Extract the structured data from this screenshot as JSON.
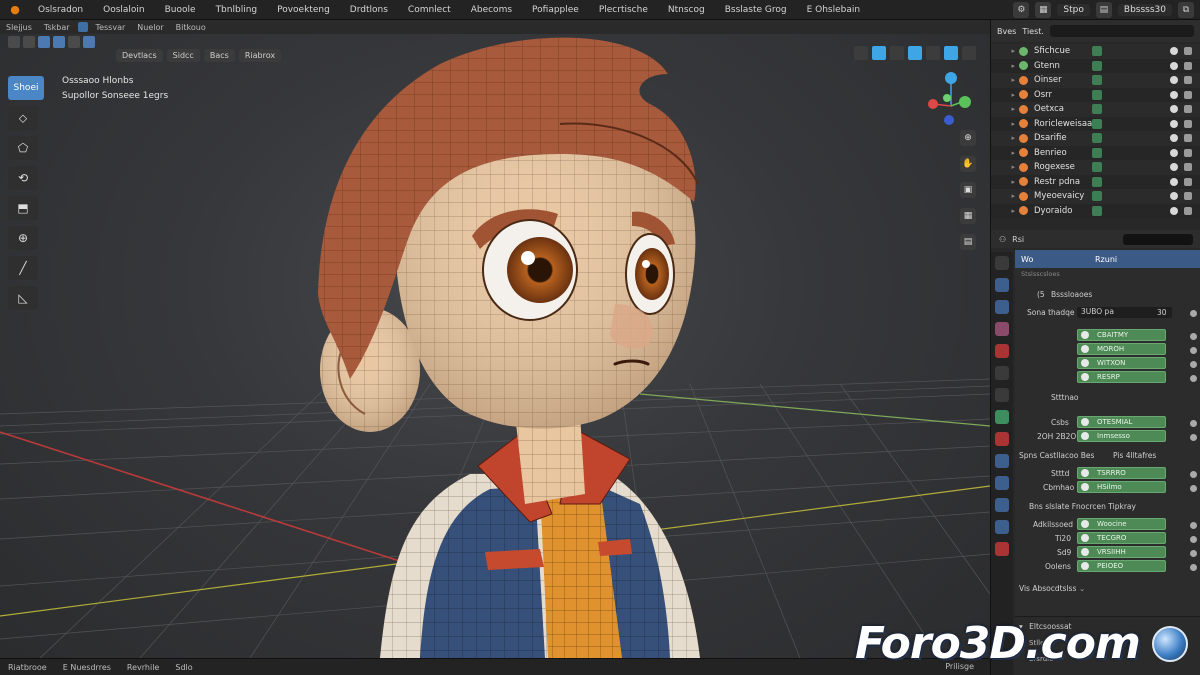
{
  "menubar": {
    "items": [
      "Oslsradon",
      "Ooslaloin",
      "Buoole",
      "Tbnlbling",
      "Povoekteng",
      "Drdtlons",
      "Comnlect",
      "Abecoms",
      "Pofiapplee",
      "Plecrtische",
      "Ntnscog",
      "Bsslaste Grog",
      "E Ohslebain"
    ],
    "scene_name": "Bbssss30",
    "scene_label": "Stpo"
  },
  "header2": {
    "items": [
      "Slejjus",
      "Tskbar",
      "Tessvar",
      "Nuelor",
      "Bitkouo"
    ]
  },
  "viewport": {
    "mode_buttons": [
      "Devtlacs",
      "Sidcc",
      "Bacs",
      "Riabrox"
    ],
    "overlay_line1": "Osssaoo Hlonbs",
    "overlay_line2": "Supollor Sonseee 1egrs",
    "tools": [
      "Shoei",
      "⬦",
      "⬠",
      "⟲",
      "⬒",
      "⊕",
      "╱",
      "◺"
    ]
  },
  "statusbar": {
    "items": [
      "Riatbrooe",
      "E Nuesdrres",
      "Revrhile",
      "Sdlo"
    ],
    "right_text": "Prilisge"
  },
  "outliner": {
    "tab_label": "Bves",
    "tab_label2": "Tiest.",
    "rows": [
      {
        "label": "Sfichcue",
        "obj": "green"
      },
      {
        "label": "Gtenn",
        "obj": "green"
      },
      {
        "label": "Oinser",
        "obj": "orange"
      },
      {
        "label": "Osrr",
        "obj": "orange"
      },
      {
        "label": "Oetxca",
        "obj": "orange"
      },
      {
        "label": "Roricleweisaar",
        "obj": "orange"
      },
      {
        "label": "Dsarifie",
        "obj": "orange"
      },
      {
        "label": "Benrieo",
        "obj": "orange"
      },
      {
        "label": "Rogexese",
        "obj": "orange"
      },
      {
        "label": "Restr pdna",
        "obj": "orange"
      },
      {
        "label": "Myeoevaicy",
        "obj": "orange"
      },
      {
        "label": "Dyoraido",
        "obj": "orange"
      }
    ]
  },
  "properties": {
    "head_label": "Rsi",
    "title_left": "Wo",
    "title_center": "Rzuni",
    "subtitle": "Stslsscsloes",
    "group1_title": "Bsssloaoes",
    "group1_label": "Sona thadqe",
    "group1_value": "3UBO pa",
    "group1_num": "30",
    "group1_buttons": [
      "CBAITMY",
      "MOROH",
      "WITXON",
      "RESRP"
    ],
    "label_sttnao": "Stttnao",
    "row_label_a": "Csbs",
    "row_label_b": "2OH 2B2O",
    "btn_a": "OTESMIAL",
    "btn_b": "Inmsesso",
    "section_text": "Spns Castllacoo Bes",
    "section_text2": "Pis 4lltafres",
    "row_label_c": "Stttd",
    "row_label_d": "Cbmhao",
    "btn_c": "TSRRRO",
    "btn_d": "HSilmo",
    "line_text": "Bns slslate Fnocrcen Tipkray",
    "row_label_e": "Adkilssoed",
    "row_label_f": "Ti20",
    "row_label_g": "Sd9",
    "row_label_h": "Oolens",
    "btn_e": "Woocine",
    "btn_f": "TECGRO",
    "btn_g": "VRSIIHH",
    "btn_h": "PEIOEO",
    "footer_text": "Vis Absocdtslss",
    "section2_title": "Eltcsoossat",
    "section2_row1": "Stlleaa",
    "section2_row2": "Ersrdle"
  },
  "watermark": {
    "text": "Foro3D.com"
  },
  "colors": {
    "accent_blue": "#4b86c6",
    "green_button": "#4d8a55",
    "grid_red": "#b83a3a",
    "grid_green": "#7fa85a",
    "orange_obj": "#e5813a"
  }
}
